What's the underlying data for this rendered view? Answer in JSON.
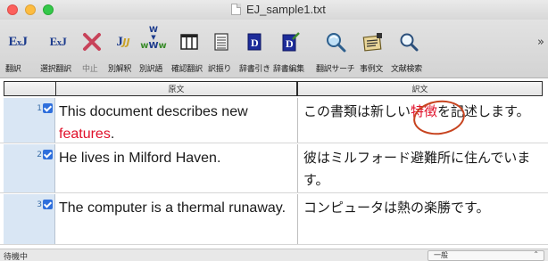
{
  "window": {
    "title": "EJ_sample1.txt"
  },
  "toolbar": {
    "items": [
      {
        "label": "翻訳",
        "icon": "exj-translate-icon",
        "glyph": "ExJ"
      },
      {
        "label": "選択翻訳",
        "icon": "exj-select-translate-icon",
        "glyph": "ExJ"
      },
      {
        "label": "中止",
        "icon": "stop-x-icon",
        "glyph": "✕"
      },
      {
        "label": "別解釈",
        "icon": "alt-interpretation-icon",
        "glyph": "J"
      },
      {
        "label": "別訳語",
        "icon": "alt-word-icon",
        "glyph": "W"
      },
      {
        "label": "確認翻訳",
        "icon": "confirm-translate-icon",
        "glyph": "▥"
      },
      {
        "label": "訳振り",
        "icon": "translation-ruby-icon",
        "glyph": "▤"
      },
      {
        "label": "辞書引き",
        "icon": "dictionary-lookup-icon",
        "glyph": "D"
      },
      {
        "label": "辞書編集",
        "icon": "dictionary-edit-icon",
        "glyph": "D"
      },
      {
        "label": "翻訳サーチ",
        "icon": "translation-search-icon",
        "glyph": "🔍"
      },
      {
        "label": "事例文",
        "icon": "example-sentence-icon",
        "glyph": "📋"
      },
      {
        "label": "文献検索",
        "icon": "literature-search-icon",
        "glyph": "🔍"
      }
    ],
    "overflow": "»"
  },
  "table": {
    "headers": {
      "source": "原文",
      "target": "訳文"
    },
    "rows": [
      {
        "num": "1",
        "source_plain": "This document describes new ",
        "source_highlight": "features",
        "source_tail": ".",
        "target_pre": "この書類は新しい",
        "target_highlight": "特徴",
        "target_post": "を記述します。"
      },
      {
        "num": "2",
        "source": "He lives in Milford Haven.",
        "target": "彼はミルフォード避難所に住んでいます。"
      },
      {
        "num": "3",
        "source": "The computer is a thermal runaway.",
        "target": "コンピュータは熱の楽勝です。"
      }
    ]
  },
  "statusbar": {
    "status": "待機中",
    "mode": "一般"
  },
  "colors": {
    "highlight": "#e0102a",
    "annotation_ring": "#c7431f",
    "check": "#2f6fdc"
  }
}
